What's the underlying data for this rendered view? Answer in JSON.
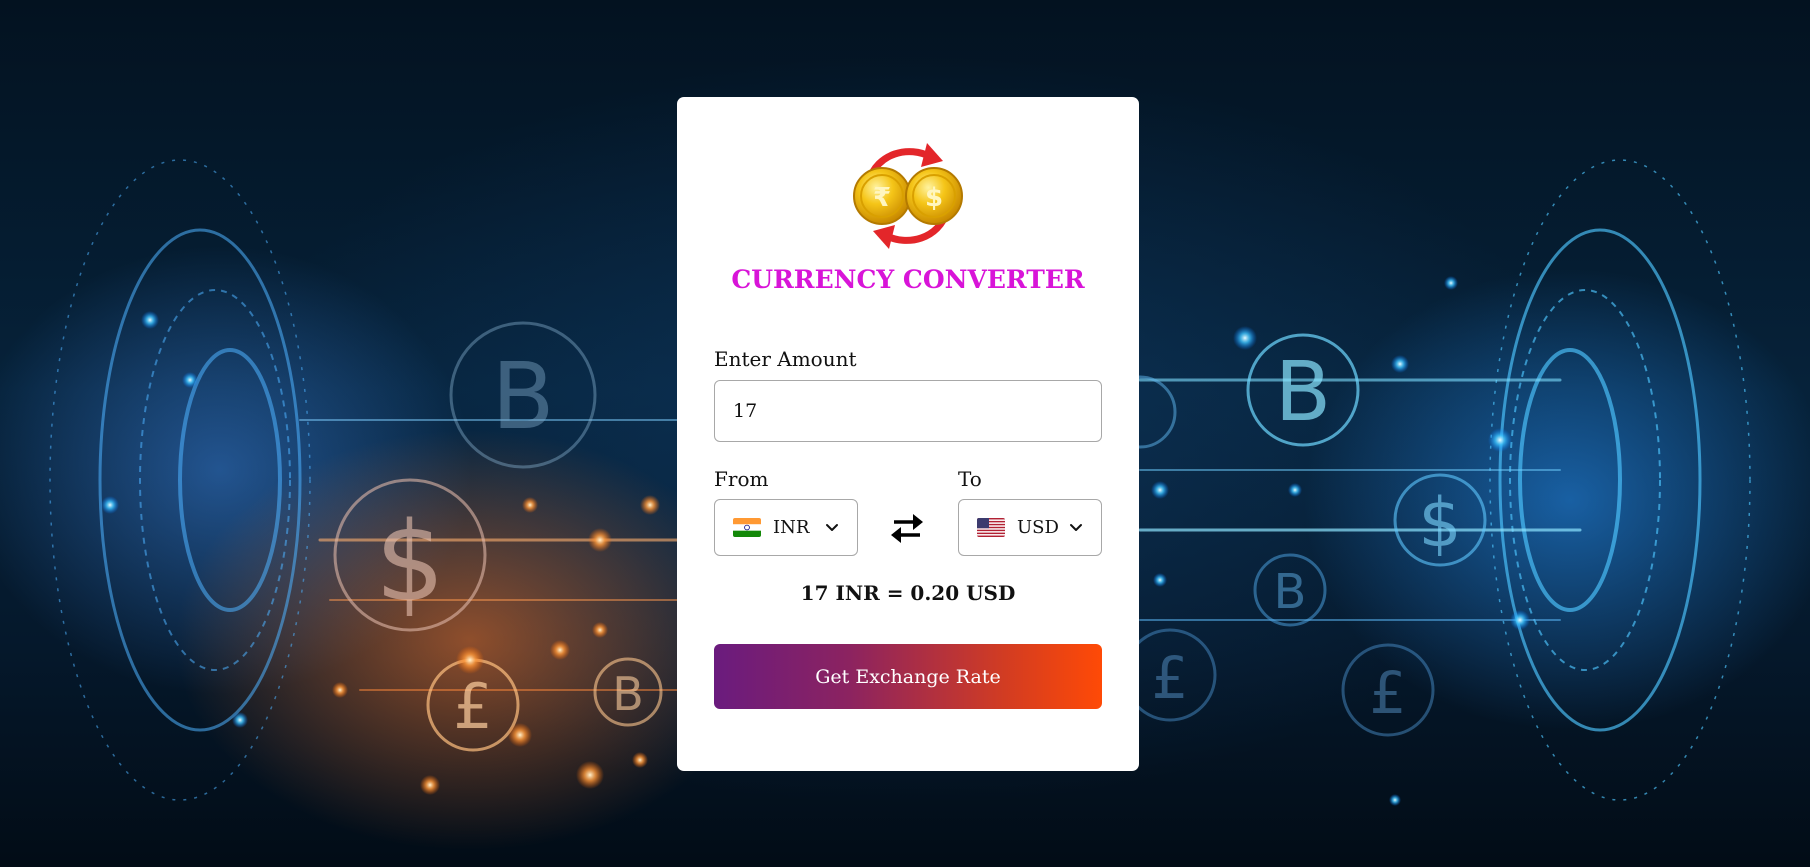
{
  "app": {
    "title": "CURRENCY CONVERTER",
    "title_color": "#d814d8"
  },
  "amount": {
    "label": "Enter Amount",
    "value": "17"
  },
  "from": {
    "label": "From",
    "currency": "INR",
    "flag_icon": "india-flag-icon"
  },
  "to": {
    "label": "To",
    "currency": "USD",
    "flag_icon": "usa-flag-icon"
  },
  "swap_icon": "swap-arrows-icon",
  "result": {
    "text": "17 INR = 0.20 USD"
  },
  "action": {
    "button_label": "Get Exchange Rate",
    "gradient_start": "#6a1b7e",
    "gradient_end": "#ff4a06"
  },
  "logo_icon": "currency-exchange-coins-icon"
}
